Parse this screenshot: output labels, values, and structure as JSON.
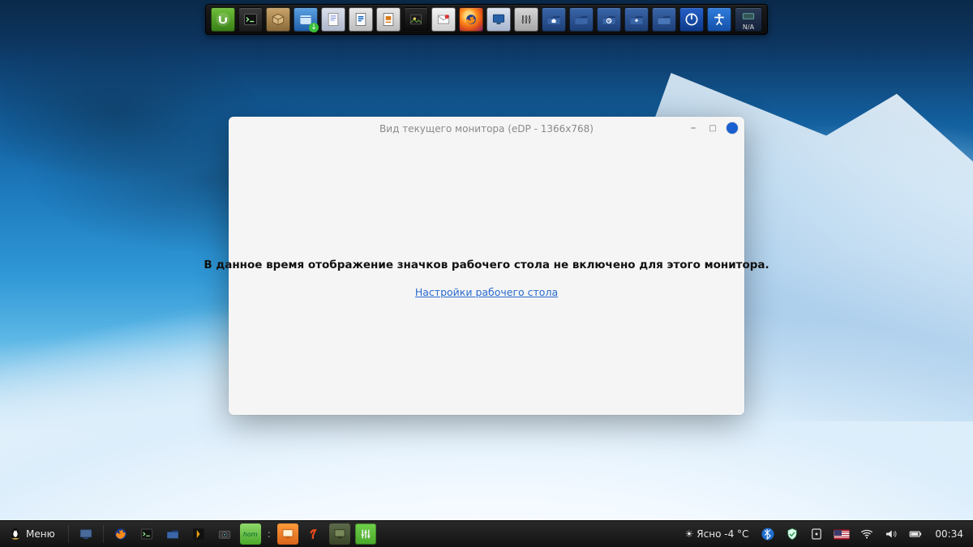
{
  "dock": {
    "items": [
      {
        "name": "mint-menu-icon",
        "title": "Linux Mint"
      },
      {
        "name": "terminal-icon",
        "title": "Terminal"
      },
      {
        "name": "package-manager-icon",
        "title": "Package"
      },
      {
        "name": "downloads-icon",
        "title": "Downloads"
      },
      {
        "name": "notes-icon",
        "title": "Notes"
      },
      {
        "name": "libreoffice-writer-icon",
        "title": "Writer"
      },
      {
        "name": "libreoffice-impress-icon",
        "title": "Impress"
      },
      {
        "name": "image-viewer-icon",
        "title": "Image"
      },
      {
        "name": "mail-icon",
        "title": "Mail"
      },
      {
        "name": "firefox-icon",
        "title": "Firefox"
      },
      {
        "name": "monitor-settings-icon",
        "title": "Display"
      },
      {
        "name": "audio-mixer-icon",
        "title": "Mixer"
      },
      {
        "name": "home-folder-icon",
        "title": "Home"
      },
      {
        "name": "folder-icon",
        "title": "Folder"
      },
      {
        "name": "backup-icon",
        "title": "Backup"
      },
      {
        "name": "downloads-folder-icon",
        "title": "Downloads"
      },
      {
        "name": "folder-open-icon",
        "title": "Folder"
      },
      {
        "name": "power-icon",
        "title": "Shutdown"
      },
      {
        "name": "accessibility-icon",
        "title": "Accessibility"
      },
      {
        "name": "cpu-temp-na",
        "title": "N/A"
      }
    ],
    "na_label": "N/A"
  },
  "window": {
    "title": "Вид текущего монитора (eDP - 1366x768)",
    "message": "В данное время отображение значков рабочего стола не включено для этого монитора.",
    "link": "Настройки рабочего стола"
  },
  "taskbar": {
    "menu_label": "Меню",
    "weather_text": "Ясно -4 °C",
    "clock": "00:34",
    "launchers": [
      {
        "name": "tux-icon"
      },
      {
        "name": "show-desktop-icon"
      },
      {
        "name": "firefox-launcher-icon"
      },
      {
        "name": "terminal-launcher-icon"
      },
      {
        "name": "files-launcher-icon"
      },
      {
        "name": "plex-icon"
      },
      {
        "name": "camera-icon"
      },
      {
        "name": "homebank-icon"
      }
    ],
    "running": [
      {
        "name": "display-window-task",
        "active": false
      },
      {
        "name": "yandex-icon",
        "active": false
      },
      {
        "name": "file-manager-task",
        "active": false
      },
      {
        "name": "mixer-task",
        "active": true
      }
    ],
    "tray": [
      {
        "name": "bluetooth-icon"
      },
      {
        "name": "shield-icon"
      },
      {
        "name": "update-manager-icon"
      },
      {
        "name": "keyboard-layout-flag"
      },
      {
        "name": "wifi-icon"
      },
      {
        "name": "volume-icon"
      },
      {
        "name": "battery-icon"
      }
    ]
  }
}
